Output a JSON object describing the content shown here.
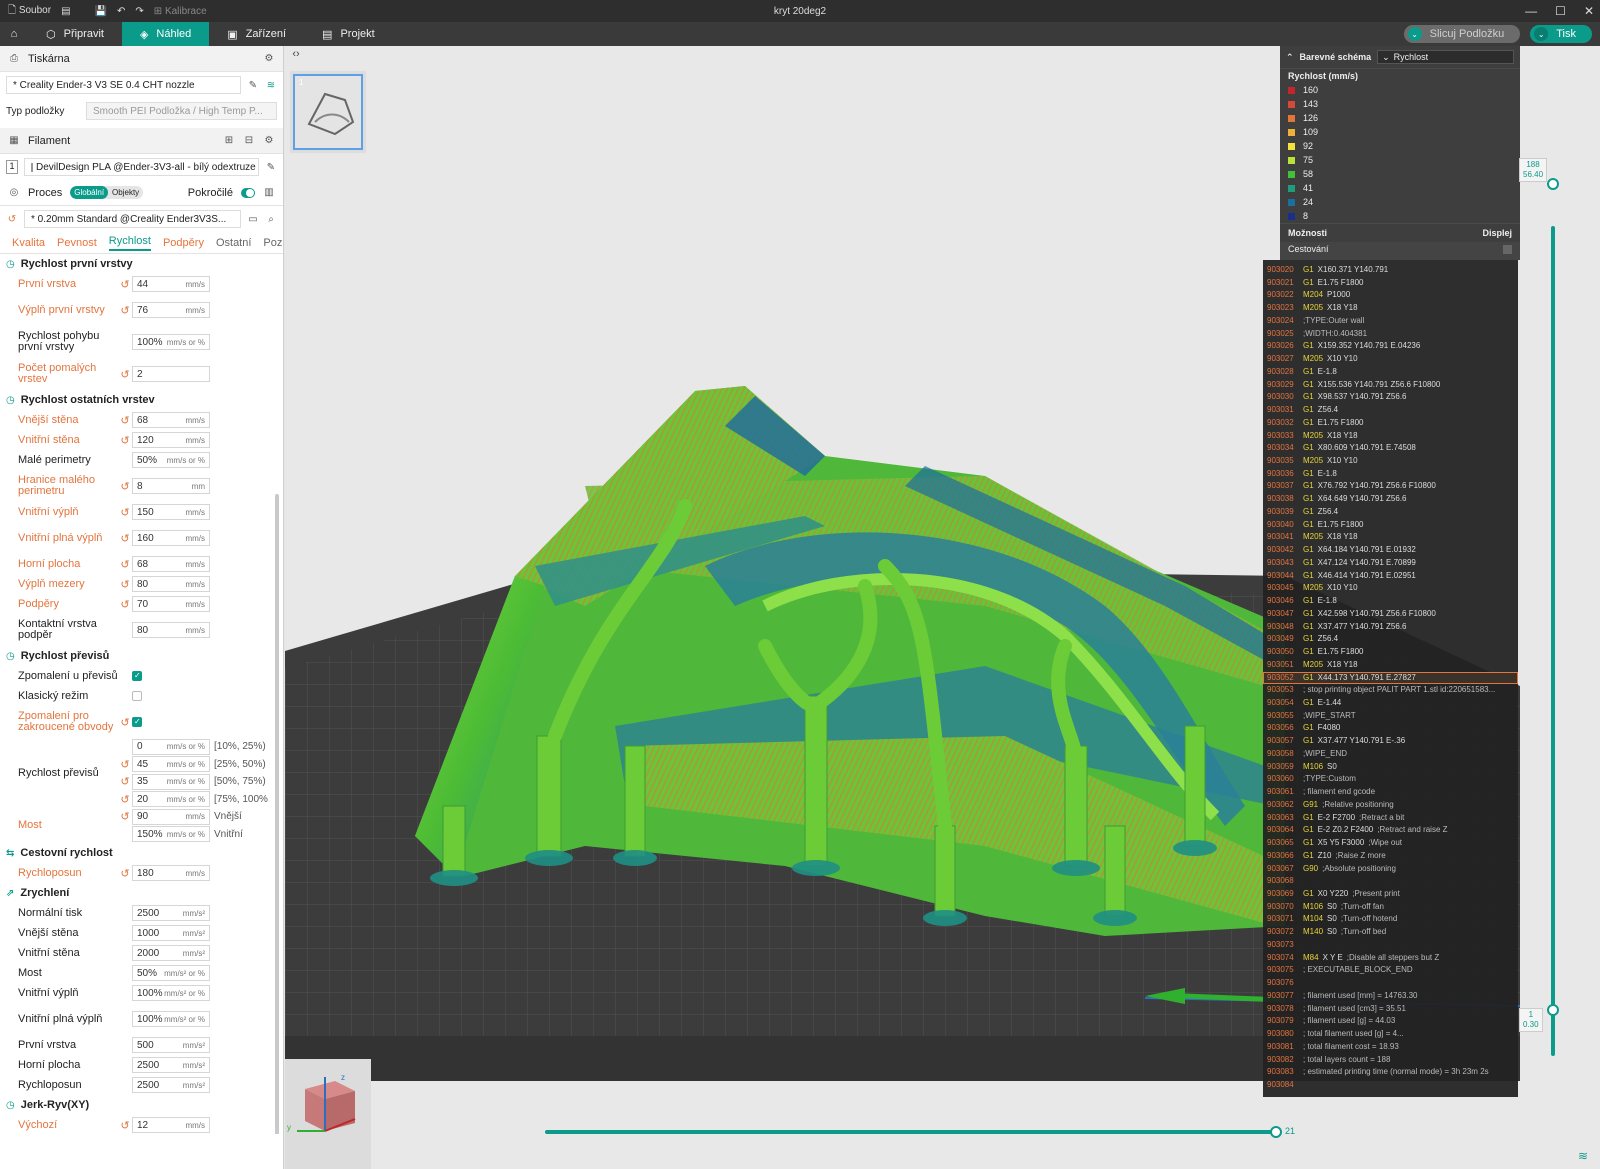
{
  "window": {
    "menu_file": "Soubor",
    "calibrate": "Kalibrace",
    "title": "kryt 20deg2",
    "min": "—",
    "max": "☐",
    "close": "✕"
  },
  "toolbar": {
    "tabs": [
      "Připravit",
      "Náhled",
      "Zařízení",
      "Projekt"
    ],
    "slice": "Slicuj Podložku",
    "print": "Tisk"
  },
  "printer": {
    "section": "Tiskárna",
    "name": "* Creality Ender-3 V3 SE 0.4 CHT nozzle",
    "plate_label": "Typ podložky",
    "plate_value": "Smooth PEI Podložka / High Temp P..."
  },
  "filament": {
    "section": "Filament",
    "slot": "1",
    "name": "DevilDesign PLA @Ender-3V3-all - bílý odextruze"
  },
  "process": {
    "section": "Proces",
    "toggle_global": "Globální",
    "toggle_objects": "Objekty",
    "advanced": "Pokročilé",
    "preset": "* 0.20mm Standard @Creality Ender3V3S..."
  },
  "subtabs": [
    "Kvalita",
    "Pevnost",
    "Rychlost",
    "Podpěry",
    "Ostatní",
    "Pozná..."
  ],
  "groups": {
    "first_layer": "Rychlost první vrstvy",
    "other_layers": "Rychlost ostatních vrstev",
    "overhang": "Rychlost převisů",
    "travel": "Cestovní rychlost",
    "accel": "Zrychlení",
    "jerk": "Jerk-Ryv(XY)"
  },
  "params": {
    "first_layer": [
      {
        "label": "První vrstva",
        "value": "44",
        "unit": "mm/s",
        "mod": true
      },
      {
        "label": "Výplň první vrstvy",
        "value": "76",
        "unit": "mm/s",
        "mod": true
      },
      {
        "label": "Rychlost pohybu první vrstvy",
        "value": "100%",
        "unit": "mm/s or %",
        "mod": false
      },
      {
        "label": "Počet pomalých vrstev",
        "value": "2",
        "unit": "",
        "mod": true
      }
    ],
    "other_layers": [
      {
        "label": "Vnější stěna",
        "value": "68",
        "unit": "mm/s",
        "mod": true
      },
      {
        "label": "Vnitřní stěna",
        "value": "120",
        "unit": "mm/s",
        "mod": true
      },
      {
        "label": "Malé perimetry",
        "value": "50%",
        "unit": "mm/s or %",
        "mod": false
      },
      {
        "label": "Hranice malého perimetru",
        "value": "8",
        "unit": "mm",
        "mod": true
      },
      {
        "label": "Vnitřní výplň",
        "value": "150",
        "unit": "mm/s",
        "mod": true
      },
      {
        "label": "Vnitřní plná výplň",
        "value": "160",
        "unit": "mm/s",
        "mod": true
      },
      {
        "label": "Horní plocha",
        "value": "68",
        "unit": "mm/s",
        "mod": true
      },
      {
        "label": "Výplň mezery",
        "value": "80",
        "unit": "mm/s",
        "mod": true
      },
      {
        "label": "Podpěry",
        "value": "70",
        "unit": "mm/s",
        "mod": true
      },
      {
        "label": "Kontaktní vrstva podpěr",
        "value": "80",
        "unit": "mm/s",
        "mod": false
      }
    ],
    "overhang_checks": [
      {
        "label": "Zpomalení u převisů",
        "checked": true,
        "mod": false
      },
      {
        "label": "Klasický režim",
        "checked": false,
        "mod": false
      },
      {
        "label": "Zpomalení pro zakroucené obvody",
        "checked": true,
        "mod": true
      }
    ],
    "overhang_label": "Rychlost převisů",
    "overhang_speeds": [
      {
        "value": "0",
        "unit": "mm/s or %",
        "range": "[10%, 25%)",
        "mod": false
      },
      {
        "value": "45",
        "unit": "mm/s or %",
        "range": "[25%, 50%)",
        "mod": true
      },
      {
        "value": "35",
        "unit": "mm/s or %",
        "range": "[50%, 75%)",
        "mod": true
      },
      {
        "value": "20",
        "unit": "mm/s or %",
        "range": "[75%, 100%",
        "mod": true
      }
    ],
    "bridge_label": "Most",
    "bridge": [
      {
        "value": "90",
        "unit": "mm/s",
        "extra": "Vnější",
        "mod": true
      },
      {
        "value": "150%",
        "unit": "mm/s or %",
        "extra": "Vnitřní",
        "mod": false
      }
    ],
    "travel": [
      {
        "label": "Rychloposun",
        "value": "180",
        "unit": "mm/s",
        "mod": true
      }
    ],
    "accel": [
      {
        "label": "Normální tisk",
        "value": "2500",
        "unit": "mm/s²",
        "mod": false
      },
      {
        "label": "Vnější stěna",
        "value": "1000",
        "unit": "mm/s²",
        "mod": false
      },
      {
        "label": "Vnitřní stěna",
        "value": "2000",
        "unit": "mm/s²",
        "mod": false
      },
      {
        "label": "Most",
        "value": "50%",
        "unit": "mm/s² or %",
        "mod": false
      },
      {
        "label": "Vnitřní výplň",
        "value": "100%",
        "unit": "mm/s² or %",
        "mod": false
      },
      {
        "label": "Vnitřní plná výplň",
        "value": "100%",
        "unit": "mm/s² or %",
        "mod": false
      },
      {
        "label": "První vrstva",
        "value": "500",
        "unit": "mm/s²",
        "mod": false
      },
      {
        "label": "Horní plocha",
        "value": "2500",
        "unit": "mm/s²",
        "mod": false
      },
      {
        "label": "Rychloposun",
        "value": "2500",
        "unit": "mm/s²",
        "mod": false
      }
    ],
    "jerk": [
      {
        "label": "Výchozí",
        "value": "12",
        "unit": "mm/s",
        "mod": true
      }
    ]
  },
  "legend": {
    "title": "Barevné schéma",
    "scheme": "Rychlost",
    "subtitle": "Rychlost (mm/s)",
    "items": [
      {
        "value": "160",
        "color": "#c0262b"
      },
      {
        "value": "143",
        "color": "#d4493a"
      },
      {
        "value": "126",
        "color": "#e1763a"
      },
      {
        "value": "109",
        "color": "#eeb23a"
      },
      {
        "value": "92",
        "color": "#f1e33a"
      },
      {
        "value": "75",
        "color": "#b9e33a"
      },
      {
        "value": "58",
        "color": "#3fc23a"
      },
      {
        "value": "41",
        "color": "#1f9c7a"
      },
      {
        "value": "24",
        "color": "#1a6ea0"
      },
      {
        "value": "8",
        "color": "#1a2f8a"
      }
    ],
    "options": "Možnosti",
    "display": "Displej",
    "travel": "Cestování"
  },
  "gcode": [
    {
      "n": "903020",
      "c": "G1",
      "a": "X160.371 Y140.791",
      "m": ""
    },
    {
      "n": "903021",
      "c": "G1",
      "a": "E1.75 F1800",
      "m": ""
    },
    {
      "n": "903022",
      "c": "M204",
      "a": "P1000",
      "m": ""
    },
    {
      "n": "903023",
      "c": "M205",
      "a": "X18 Y18",
      "m": ""
    },
    {
      "n": "903024",
      "c": "",
      "a": "",
      "m": ";TYPE:Outer wall"
    },
    {
      "n": "903025",
      "c": "",
      "a": "",
      "m": ";WIDTH:0.404381"
    },
    {
      "n": "903026",
      "c": "G1",
      "a": "X159.352 Y140.791 E.04236",
      "m": ""
    },
    {
      "n": "903027",
      "c": "M205",
      "a": "X10 Y10",
      "m": ""
    },
    {
      "n": "903028",
      "c": "G1",
      "a": "E-1.8",
      "m": ""
    },
    {
      "n": "903029",
      "c": "G1",
      "a": "X155.536 Y140.791 Z56.6 F10800",
      "m": ""
    },
    {
      "n": "903030",
      "c": "G1",
      "a": "X98.537 Y140.791 Z56.6",
      "m": ""
    },
    {
      "n": "903031",
      "c": "G1",
      "a": "Z56.4",
      "m": ""
    },
    {
      "n": "903032",
      "c": "G1",
      "a": "E1.75 F1800",
      "m": ""
    },
    {
      "n": "903033",
      "c": "M205",
      "a": "X18 Y18",
      "m": ""
    },
    {
      "n": "903034",
      "c": "G1",
      "a": "X80.609 Y140.791 E.74508",
      "m": ""
    },
    {
      "n": "903035",
      "c": "M205",
      "a": "X10 Y10",
      "m": ""
    },
    {
      "n": "903036",
      "c": "G1",
      "a": "E-1.8",
      "m": ""
    },
    {
      "n": "903037",
      "c": "G1",
      "a": "X76.792 Y140.791 Z56.6 F10800",
      "m": ""
    },
    {
      "n": "903038",
      "c": "G1",
      "a": "X64.649 Y140.791 Z56.6",
      "m": ""
    },
    {
      "n": "903039",
      "c": "G1",
      "a": "Z56.4",
      "m": ""
    },
    {
      "n": "903040",
      "c": "G1",
      "a": "E1.75 F1800",
      "m": ""
    },
    {
      "n": "903041",
      "c": "M205",
      "a": "X18 Y18",
      "m": ""
    },
    {
      "n": "903042",
      "c": "G1",
      "a": "X64.184 Y140.791 E.01932",
      "m": ""
    },
    {
      "n": "903043",
      "c": "G1",
      "a": "X47.124 Y140.791 E.70899",
      "m": ""
    },
    {
      "n": "903044",
      "c": "G1",
      "a": "X46.414 Y140.791 E.02951",
      "m": ""
    },
    {
      "n": "903045",
      "c": "M205",
      "a": "X10 Y10",
      "m": ""
    },
    {
      "n": "903046",
      "c": "G1",
      "a": "E-1.8",
      "m": ""
    },
    {
      "n": "903047",
      "c": "G1",
      "a": "X42.598 Y140.791 Z56.6 F10800",
      "m": ""
    },
    {
      "n": "903048",
      "c": "G1",
      "a": "X37.477 Y140.791 Z56.6",
      "m": ""
    },
    {
      "n": "903049",
      "c": "G1",
      "a": "Z56.4",
      "m": ""
    },
    {
      "n": "903050",
      "c": "G1",
      "a": "E1.75 F1800",
      "m": ""
    },
    {
      "n": "903051",
      "c": "M205",
      "a": "X18 Y18",
      "m": ""
    },
    {
      "n": "903052",
      "c": "G1",
      "a": "X44.173 Y140.791 E.27827",
      "m": "",
      "sel": true
    },
    {
      "n": "903053",
      "c": "",
      "a": "",
      "m": "; stop printing object PALIT PART 1.stl id:220651583..."
    },
    {
      "n": "903054",
      "c": "G1",
      "a": "E-1.44",
      "m": ""
    },
    {
      "n": "903055",
      "c": "",
      "a": "",
      "m": ";WIPE_START"
    },
    {
      "n": "903056",
      "c": "G1",
      "a": "F4080",
      "m": ""
    },
    {
      "n": "903057",
      "c": "G1",
      "a": "X37.477 Y140.791 E-.36",
      "m": ""
    },
    {
      "n": "903058",
      "c": "",
      "a": "",
      "m": ";WIPE_END"
    },
    {
      "n": "903059",
      "c": "M106",
      "a": "S0",
      "m": ""
    },
    {
      "n": "903060",
      "c": "",
      "a": "",
      "m": ";TYPE:Custom"
    },
    {
      "n": "903061",
      "c": "",
      "a": "",
      "m": "; filament end gcode"
    },
    {
      "n": "903062",
      "c": "G91",
      "a": "",
      "m": ";Relative positioning"
    },
    {
      "n": "903063",
      "c": "G1",
      "a": "E-2 F2700",
      "m": ";Retract a bit"
    },
    {
      "n": "903064",
      "c": "G1",
      "a": "E-2 Z0.2 F2400",
      "m": ";Retract and raise Z"
    },
    {
      "n": "903065",
      "c": "G1",
      "a": "X5 Y5 F3000",
      "m": ";Wipe out"
    },
    {
      "n": "903066",
      "c": "G1",
      "a": "Z10",
      "m": ";Raise Z more"
    },
    {
      "n": "903067",
      "c": "G90",
      "a": "",
      "m": ";Absolute positioning"
    },
    {
      "n": "903068",
      "c": "",
      "a": "",
      "m": ""
    },
    {
      "n": "903069",
      "c": "G1",
      "a": "X0 Y220",
      "m": ";Present print"
    },
    {
      "n": "903070",
      "c": "M106",
      "a": "S0",
      "m": ";Turn-off fan"
    },
    {
      "n": "903071",
      "c": "M104",
      "a": "S0",
      "m": ";Turn-off hotend"
    },
    {
      "n": "903072",
      "c": "M140",
      "a": "S0",
      "m": ";Turn-off bed"
    },
    {
      "n": "903073",
      "c": "",
      "a": "",
      "m": ""
    },
    {
      "n": "903074",
      "c": "M84",
      "a": "X Y E",
      "m": ";Disable all steppers but Z"
    },
    {
      "n": "903075",
      "c": "",
      "a": "",
      "m": "; EXECUTABLE_BLOCK_END"
    },
    {
      "n": "903076",
      "c": "",
      "a": "",
      "m": ""
    },
    {
      "n": "903077",
      "c": "",
      "a": "",
      "m": "; filament used [mm] = 14763.30"
    },
    {
      "n": "903078",
      "c": "",
      "a": "",
      "m": "; filament used [cm3] = 35.51"
    },
    {
      "n": "903079",
      "c": "",
      "a": "",
      "m": "; filament used [g] = 44.03"
    },
    {
      "n": "903080",
      "c": "",
      "a": "",
      "m": "; total filament used [g] = 4..."
    },
    {
      "n": "903081",
      "c": "",
      "a": "",
      "m": "; total filament cost = 18.93"
    },
    {
      "n": "903082",
      "c": "",
      "a": "",
      "m": "; total layers count = 188"
    },
    {
      "n": "903083",
      "c": "",
      "a": "",
      "m": "; estimated printing time (normal mode) = 3h 23m 2s"
    },
    {
      "n": "903084",
      "c": "",
      "a": "",
      "m": ""
    }
  ],
  "layer_slider": {
    "top_layer": "188",
    "top_height": "56.40",
    "bottom_layer": "1",
    "bottom_height": "0.30"
  },
  "move_slider": {
    "value": "21"
  },
  "thumb_index": "1",
  "axes": {
    "y": "y",
    "z": "z",
    "x": "x"
  }
}
